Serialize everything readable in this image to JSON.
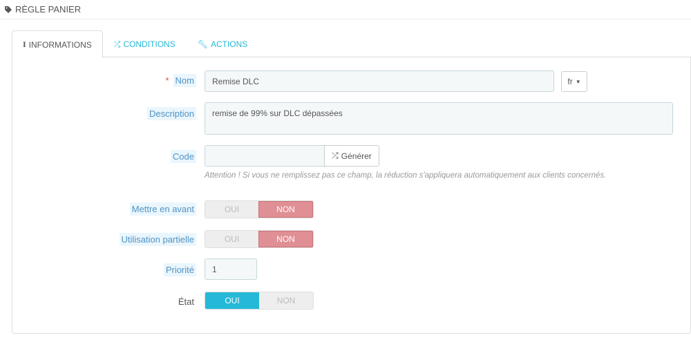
{
  "header": {
    "title": "Règle panier"
  },
  "tabs": [
    {
      "label": "Informations"
    },
    {
      "label": "Conditions"
    },
    {
      "label": "Actions"
    }
  ],
  "form": {
    "name": {
      "label": "Nom",
      "value": "Remise DLC",
      "lang": "fr"
    },
    "description": {
      "label": "Description",
      "value": "remise de 99% sur DLC dépassées"
    },
    "code": {
      "label": "Code",
      "value": "",
      "generate_label": "Générer",
      "hint": "Attention ! Si vous ne remplissez pas ce champ, la réduction s'appliquera automatiquement aux clients concernés."
    },
    "highlight": {
      "label": "Mettre en avant",
      "yes": "OUI",
      "no": "NON",
      "value": "NON"
    },
    "partial_use": {
      "label": "Utilisation partielle",
      "yes": "OUI",
      "no": "NON",
      "value": "NON"
    },
    "priority": {
      "label": "Priorité",
      "value": "1"
    },
    "status": {
      "label": "État",
      "yes": "OUI",
      "no": "NON",
      "value": "OUI"
    }
  }
}
